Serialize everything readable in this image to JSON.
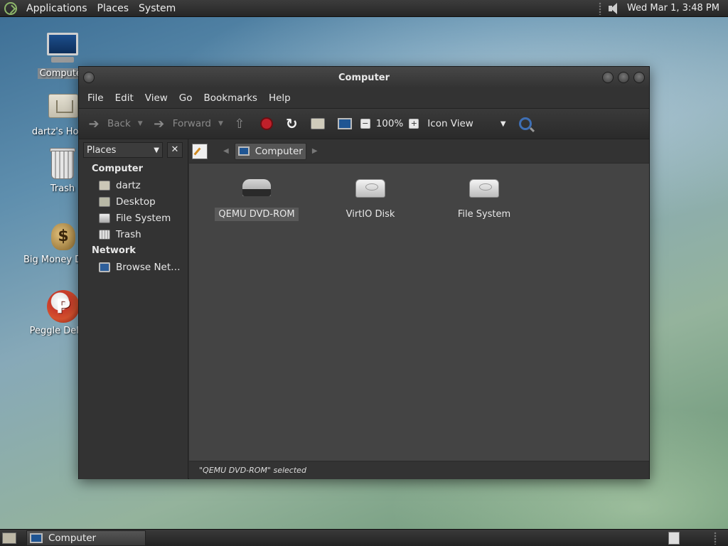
{
  "top_panel": {
    "menus": [
      "Applications",
      "Places",
      "System"
    ],
    "clock": "Wed Mar 1,  3:48 PM"
  },
  "desktop_icons": [
    {
      "label": "Computer",
      "icon": "computer-icon",
      "selected": true
    },
    {
      "label": "dartz's Home",
      "icon": "home-folder-icon"
    },
    {
      "label": "Trash",
      "icon": "trash-icon"
    },
    {
      "label": "Big Money Deluxe",
      "icon": "money-bag-icon"
    },
    {
      "label": "Peggle Deluxe",
      "icon": "peggle-icon"
    }
  ],
  "window": {
    "title": "Computer",
    "menubar": [
      "File",
      "Edit",
      "View",
      "Go",
      "Bookmarks",
      "Help"
    ],
    "toolbar": {
      "back": "Back",
      "forward": "Forward",
      "zoom": "100%",
      "view_mode": "Icon View"
    },
    "sidebar": {
      "selector": "Places",
      "close": "✕",
      "sections": [
        {
          "title": "Computer",
          "items": [
            {
              "label": "dartz",
              "icon": "home-folder-icon"
            },
            {
              "label": "Desktop",
              "icon": "desktop-folder-icon"
            },
            {
              "label": "File System",
              "icon": "drive-icon"
            },
            {
              "label": "Trash",
              "icon": "trash-icon"
            }
          ]
        },
        {
          "title": "Network",
          "items": [
            {
              "label": "Browse Net…",
              "icon": "network-icon"
            }
          ]
        }
      ]
    },
    "pathbar": {
      "crumb": "Computer"
    },
    "items": [
      {
        "label": "QEMU DVD-ROM",
        "icon": "dvd-drive-icon",
        "selected": true
      },
      {
        "label": "VirtIO Disk",
        "icon": "hard-disk-icon"
      },
      {
        "label": "File System",
        "icon": "hard-disk-icon"
      }
    ],
    "status": "\"QEMU DVD-ROM\" selected"
  },
  "taskbar": {
    "tasks": [
      {
        "label": "Computer"
      }
    ]
  }
}
